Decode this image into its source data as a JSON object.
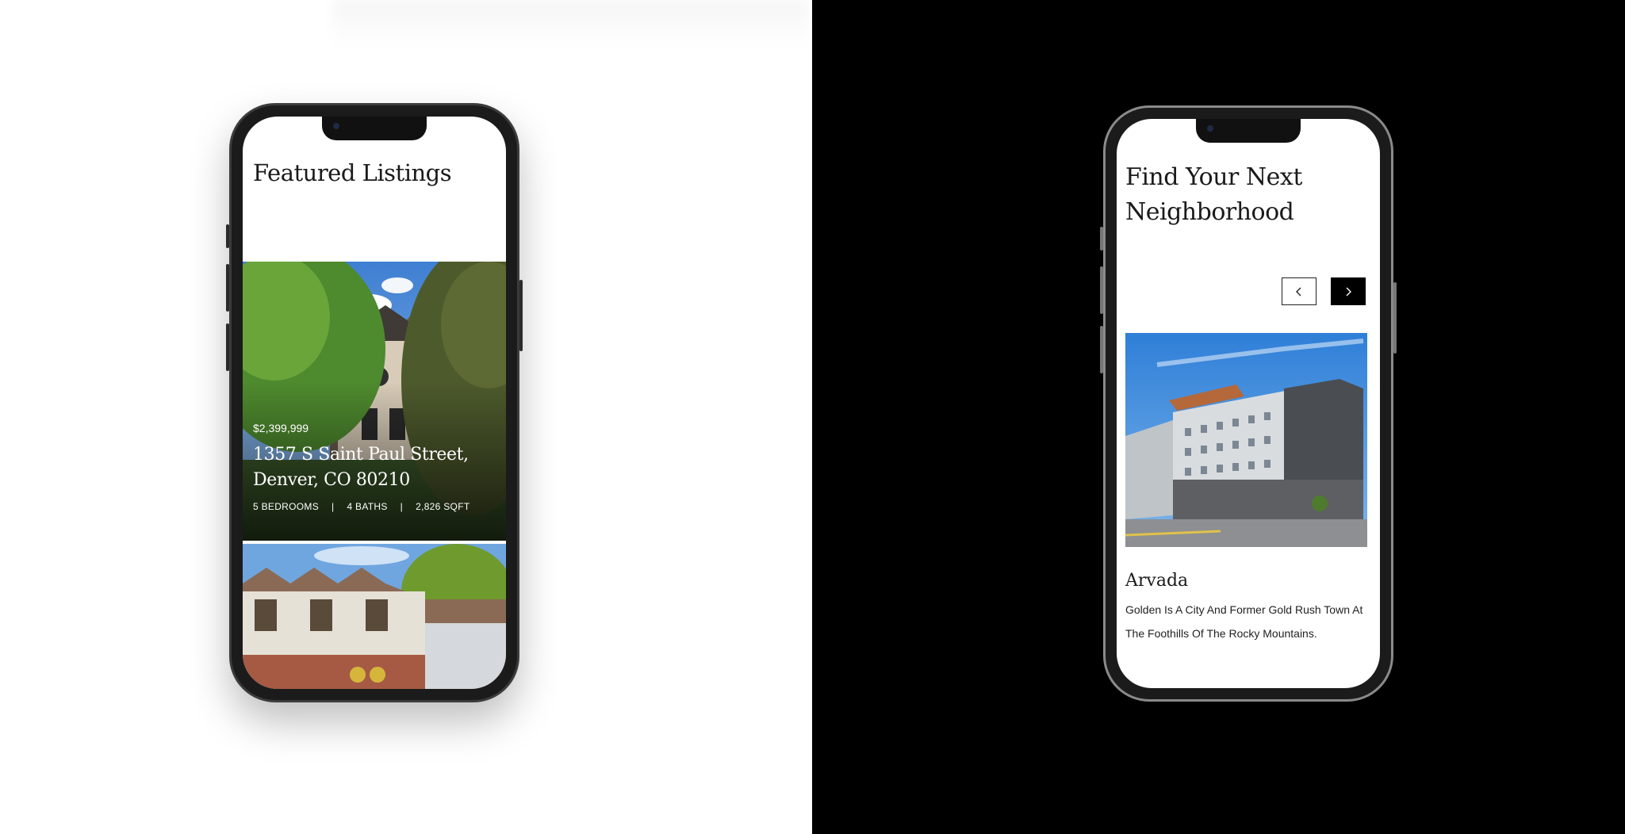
{
  "featured_screen": {
    "title": "Featured Listings",
    "listing": {
      "price": "$2,399,999",
      "address": "1357 S Saint Paul Street, Denver, CO 80210",
      "bedrooms": "5 BEDROOMS",
      "baths": "4 BATHS",
      "sqft": "2,826 SQFT",
      "separator": "|"
    }
  },
  "neighborhood_screen": {
    "title": "Find Your Next Neighborhood",
    "prev_icon": "chevron-left-icon",
    "next_icon": "chevron-right-icon",
    "neighborhood": {
      "name": "Arvada",
      "description": "Golden Is A City And Former Gold Rush Town At The Foothills Of The Rocky Mountains."
    }
  }
}
